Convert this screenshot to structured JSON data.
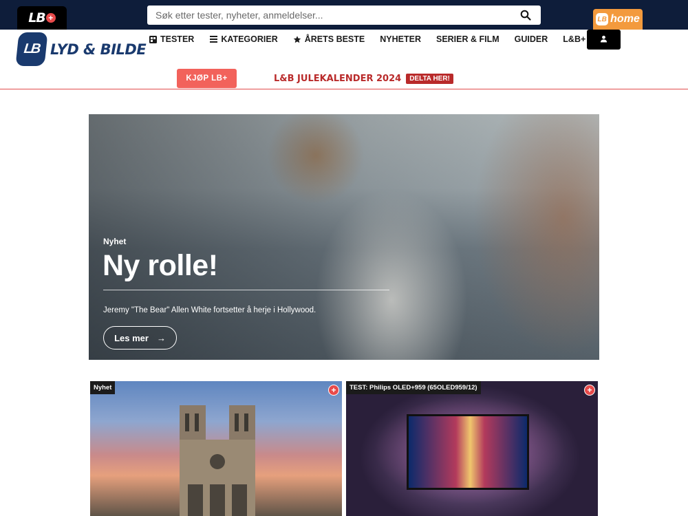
{
  "topbar": {
    "lbplus_badge": "LB",
    "search_placeholder": "Søk etter tester, nyheter, anmeldelser...",
    "home_badge": "home"
  },
  "header": {
    "logo_mark": "LB",
    "logo_text": "LYD & BILDE",
    "nav": [
      {
        "label": "TESTER",
        "icon": "grid-icon"
      },
      {
        "label": "KATEGORIER",
        "icon": "menu-icon"
      },
      {
        "label": "ÅRETS BESTE",
        "icon": "star-icon"
      },
      {
        "label": "NYHETER"
      },
      {
        "label": "SERIER & FILM"
      },
      {
        "label": "GUIDER"
      },
      {
        "label": "L&B+ VIDEO"
      }
    ]
  },
  "subbar": {
    "buy_label": "KJØP LB+",
    "calendar_title": "L&B JULEKALENDER 2024",
    "calendar_badge": "DELTA HER!"
  },
  "hero": {
    "category": "Nyhet",
    "title": "Ny rolle!",
    "description": "Jeremy \"The Bear\" Allen White fortsetter å herje i Hollywood.",
    "button_label": "Les mer",
    "button_arrow": "→"
  },
  "cards": [
    {
      "tag": "Nyhet"
    },
    {
      "tag": "TEST: Philips OLED+959 (65OLED959/12)"
    }
  ],
  "colors": {
    "topbar": "#0e1d3a",
    "brand_blue": "#1a3a6e",
    "accent_red": "#e24b4b",
    "home_orange": "#f39a3d"
  }
}
